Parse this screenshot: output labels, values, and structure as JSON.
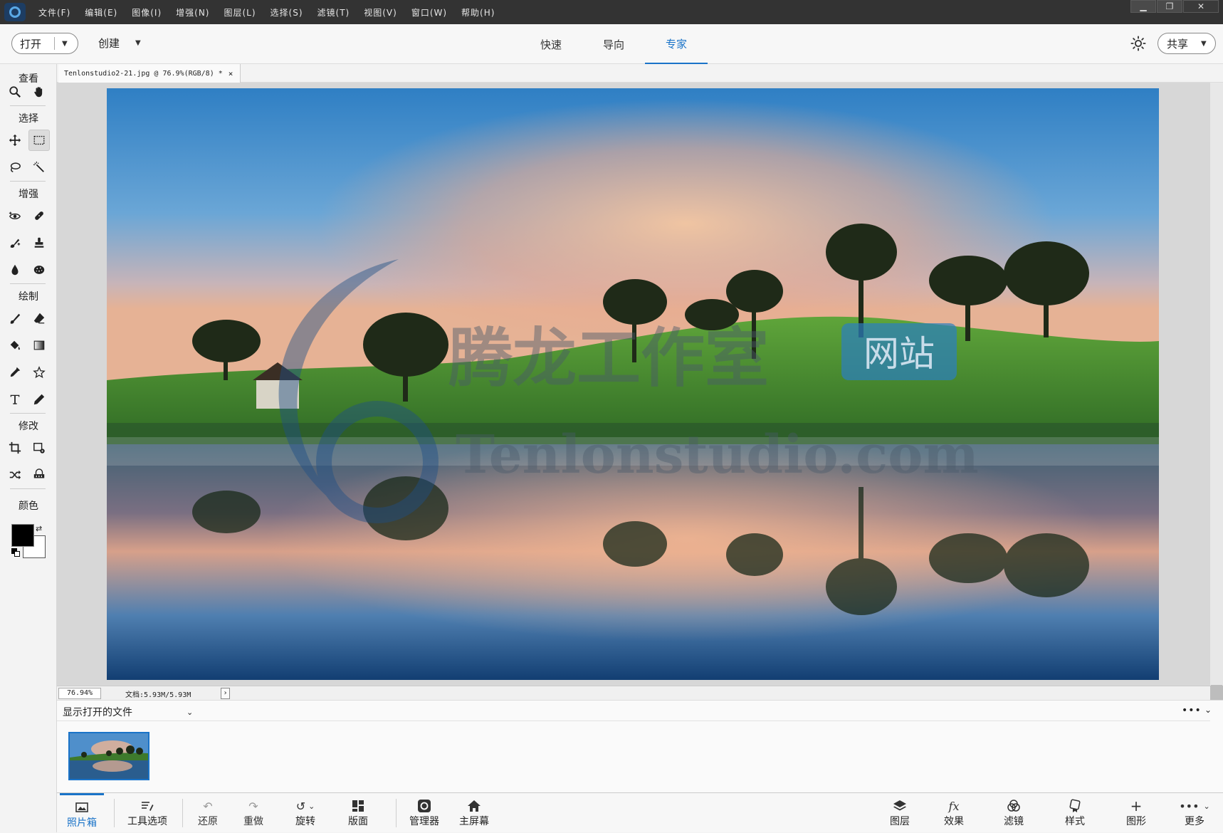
{
  "menubar": {
    "items": [
      "文件(F)",
      "编辑(E)",
      "图像(I)",
      "增强(N)",
      "图层(L)",
      "选择(S)",
      "滤镜(T)",
      "视图(V)",
      "窗口(W)",
      "帮助(H)"
    ],
    "window_controls": [
      "▁",
      "❐",
      "✕"
    ]
  },
  "toolbar": {
    "open_label": "打开",
    "create_label": "创建",
    "modes": [
      "快速",
      "导向",
      "专家"
    ],
    "active_mode": "专家",
    "share_label": "共享"
  },
  "toolbox": {
    "sections": [
      "查看",
      "选择",
      "增强",
      "绘制",
      "修改",
      "颜色"
    ],
    "foreground_color": "#000000",
    "background_color": "#ffffff"
  },
  "document": {
    "tab_title": "Tenlonstudio2-21.jpg @ 76.9%(RGB/8) *",
    "close_glyph": "×",
    "watermark_cn": "腾龙工作室",
    "watermark_badge": "网站",
    "watermark_en": "Tenlonstudio.com"
  },
  "status": {
    "zoom": "76.94%",
    "doc_size": "文档:5.93M/5.93M",
    "arrow": "›"
  },
  "photobin": {
    "dropdown_label": "显示打开的文件",
    "more": "•••"
  },
  "taskbar": {
    "left": [
      {
        "label": "照片箱",
        "icon": "photo-bin-icon"
      },
      {
        "label": "工具选项",
        "icon": "tool-options-icon"
      },
      {
        "label": "还原",
        "icon": "undo-icon"
      },
      {
        "label": "重做",
        "icon": "redo-icon"
      },
      {
        "label": "旋转",
        "icon": "rotate-icon"
      },
      {
        "label": "版面",
        "icon": "layout-icon"
      },
      {
        "label": "管理器",
        "icon": "organizer-icon"
      },
      {
        "label": "主屏幕",
        "icon": "home-icon"
      }
    ],
    "right": [
      {
        "label": "图层",
        "icon": "layers-icon"
      },
      {
        "label": "效果",
        "icon": "fx-icon"
      },
      {
        "label": "滤镜",
        "icon": "filters-icon"
      },
      {
        "label": "样式",
        "icon": "styles-icon"
      },
      {
        "label": "图形",
        "icon": "graphics-icon"
      },
      {
        "label": "更多",
        "icon": "more-icon"
      }
    ],
    "accent_color": "#1a73c8"
  }
}
